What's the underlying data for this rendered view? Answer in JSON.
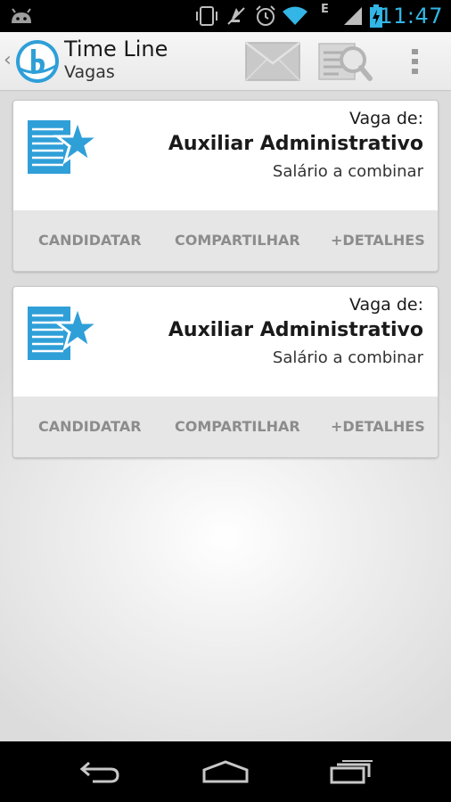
{
  "status_bar": {
    "time": "11:47",
    "network_type": "E",
    "icons": [
      "android-debug-icon",
      "vibrate-icon",
      "mute-icon",
      "alarm-icon",
      "wifi-icon",
      "signal-icon",
      "battery-charging-icon"
    ]
  },
  "action_bar": {
    "title": "Time Line",
    "subtitle": "Vagas",
    "up_icon": "chevron-left-icon",
    "logo": "app-logo-b",
    "actions": [
      "mail-icon",
      "search-document-icon",
      "overflow-menu-icon"
    ]
  },
  "jobs": [
    {
      "label": "Vaga de:",
      "title": "Auxiliar Administrativo",
      "salary": "Salário a combinar",
      "actions": {
        "apply": "CANDIDATAR",
        "share": "COMPARTILHAR",
        "details": "+DETALHES"
      }
    },
    {
      "label": "Vaga de:",
      "title": "Auxiliar Administrativo",
      "salary": "Salário a combinar",
      "actions": {
        "apply": "CANDIDATAR",
        "share": "COMPARTILHAR",
        "details": "+DETALHES"
      }
    }
  ],
  "nav_bar": {
    "buttons": [
      "back-icon",
      "home-icon",
      "recent-apps-icon"
    ]
  },
  "colors": {
    "accent": "#33b5e5",
    "job_icon": "#2f9fd8",
    "action_text": "#8c8c8c"
  }
}
